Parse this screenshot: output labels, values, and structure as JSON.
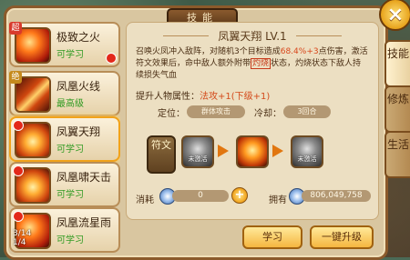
{
  "header": {
    "title": "技能"
  },
  "close_label": "×",
  "skills": [
    {
      "name": "极致之火",
      "status": "可学习",
      "tag": "超",
      "tag_color": "#d83a2c"
    },
    {
      "name": "凤凰火线",
      "status": "最高级",
      "tag": "绝",
      "tag_color": "#c58a1d"
    },
    {
      "name": "凤翼天翔",
      "status": "可学习",
      "tag": "",
      "tag_color": ""
    },
    {
      "name": "凤凰啸天击",
      "status": "可学习",
      "tag": "",
      "tag_color": ""
    },
    {
      "name": "凤凰流星雨",
      "status": "可学习",
      "tag": "",
      "tag_color": ""
    }
  ],
  "overlay": {
    "line1": "3/14",
    "line2": "1/4"
  },
  "detail": {
    "title": "凤翼天翔 LV.1",
    "desc_part1": "召唤火凤冲入敌阵，对随机3个目标造成",
    "desc_num": "68.4%+3",
    "desc_part2": "点伤害，激活符文效果后，命中敌人额外附带",
    "desc_hl": "灼烧",
    "desc_part3": "状态，灼烧状态下敌人持续损失气血",
    "attr_label": "提升人物属性：",
    "attr_value": "法攻+1(下级+1)",
    "position_label": "定位：",
    "position_value": "群体攻击",
    "cooldown_label": "冷却：",
    "cooldown_value": "3回合",
    "rune_label": "符文",
    "rune_lock_text_1": "未激活",
    "rune_lock_text_2": "未激活",
    "cost_label": "消耗",
    "cost_value": "0",
    "own_label": "拥有",
    "own_value": "806,049,758"
  },
  "buttons": {
    "learn": "学习",
    "upgrade_all": "一键升级"
  },
  "side_tabs": [
    {
      "label": "技能",
      "active": true
    },
    {
      "label": "修炼",
      "active": false
    },
    {
      "label": "生活",
      "active": false
    }
  ],
  "colors": {
    "accent": "#f1a21a",
    "status_green": "#2f9a21",
    "highlight_red": "#d34a1b"
  }
}
